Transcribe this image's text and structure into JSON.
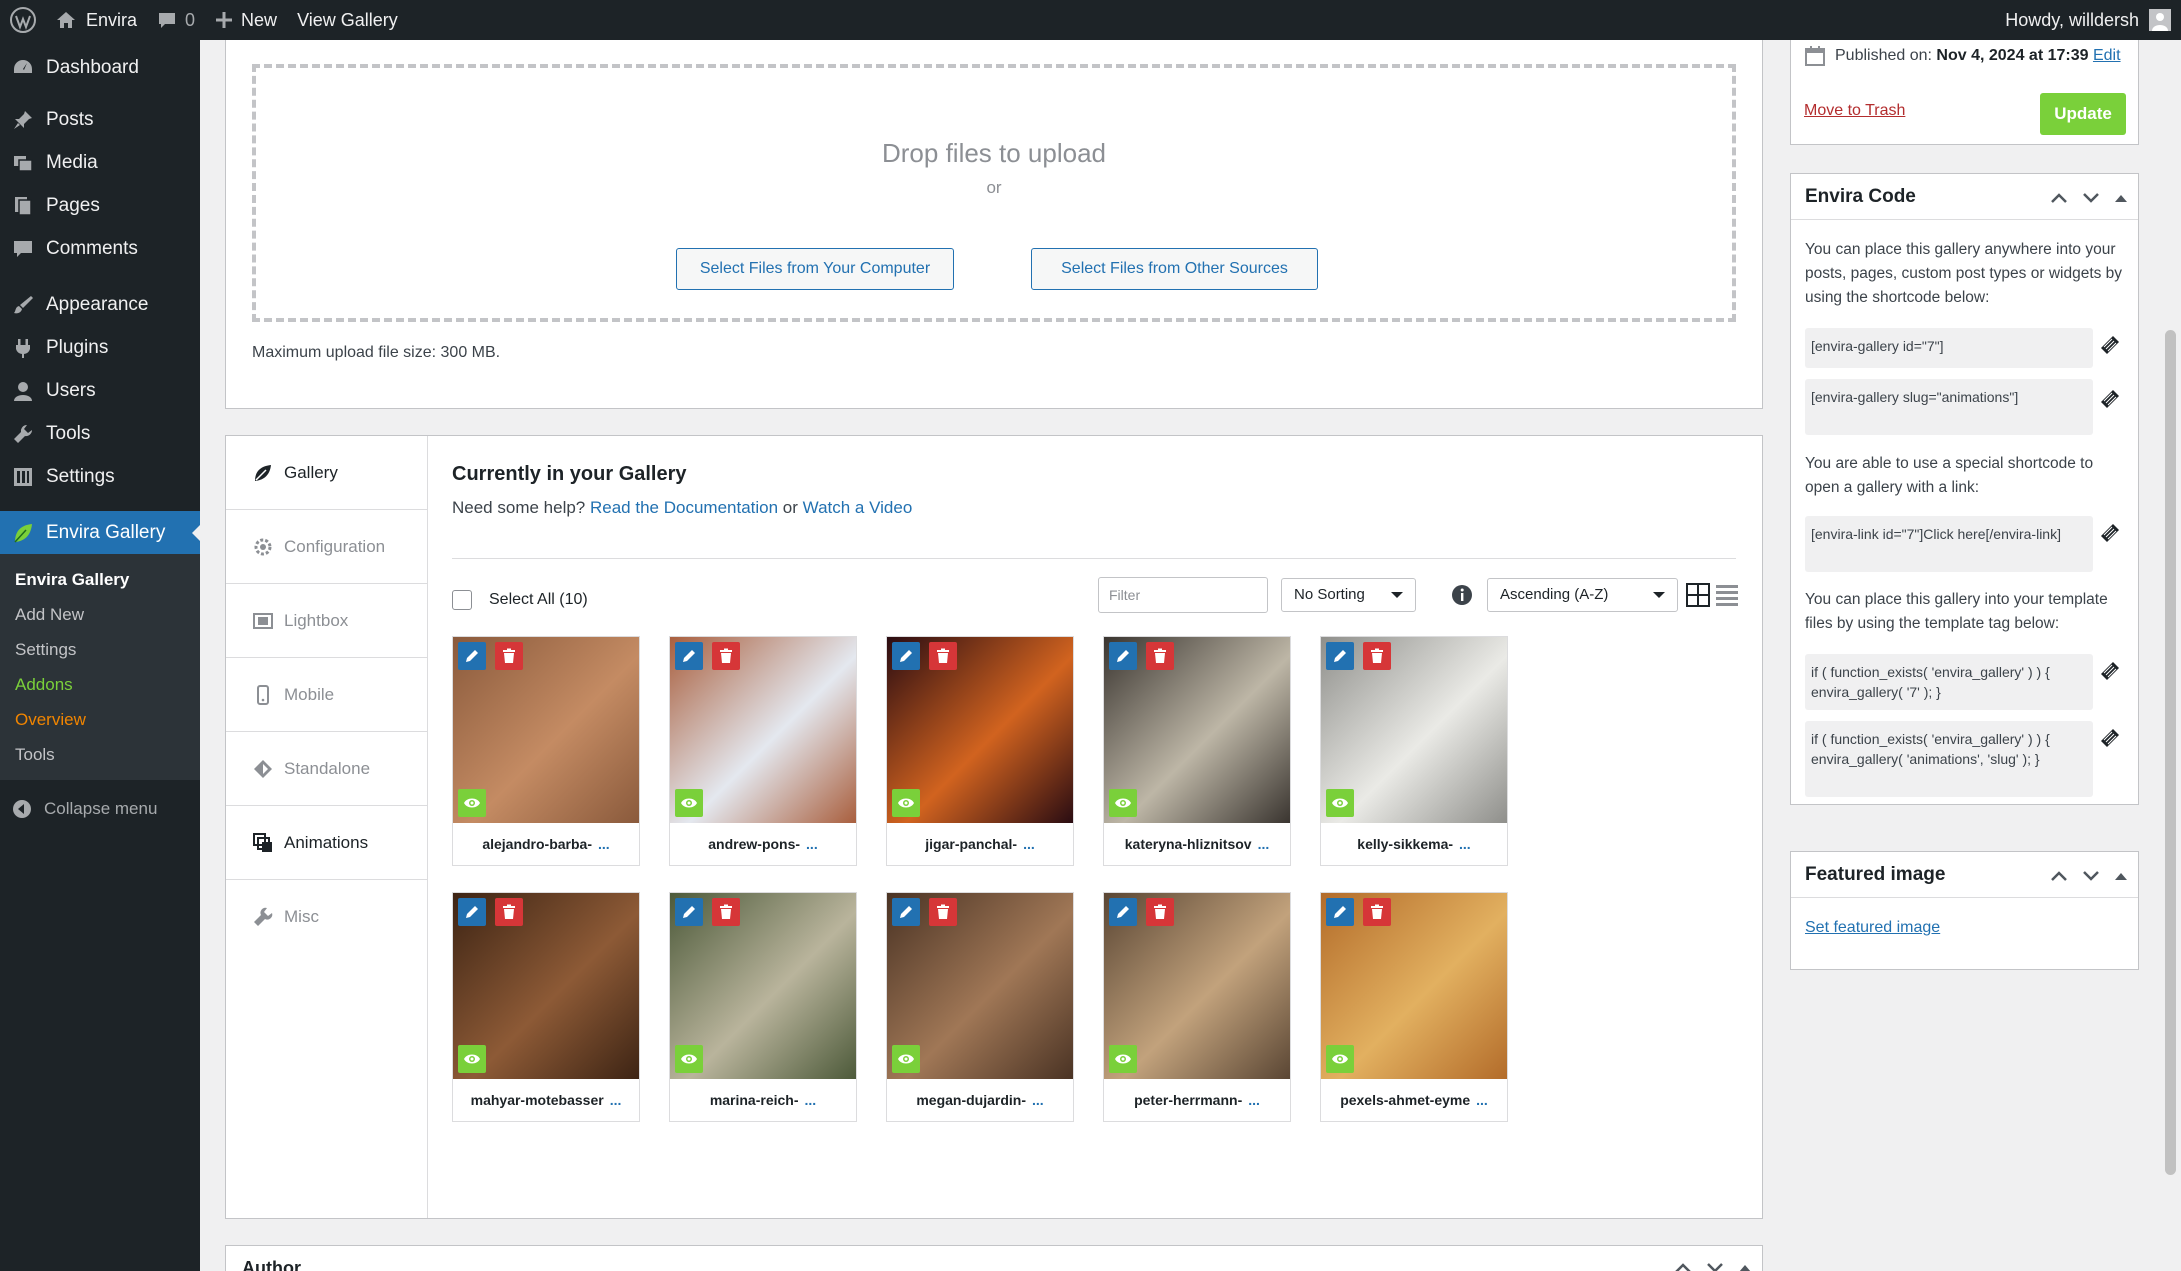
{
  "adminbar": {
    "site_name": "Envira",
    "comments_count": "0",
    "new_label": "New",
    "view_label": "View Gallery",
    "howdy": "Howdy, willdersh"
  },
  "sidebar": {
    "items": [
      {
        "label": "Dashboard",
        "icon": "dashboard-icon"
      },
      {
        "label": "Posts",
        "icon": "pin-icon"
      },
      {
        "label": "Media",
        "icon": "media-icon"
      },
      {
        "label": "Pages",
        "icon": "pages-icon"
      },
      {
        "label": "Comments",
        "icon": "comment-icon"
      },
      {
        "label": "Appearance",
        "icon": "brush-icon"
      },
      {
        "label": "Plugins",
        "icon": "plug-icon"
      },
      {
        "label": "Users",
        "icon": "user-icon"
      },
      {
        "label": "Tools",
        "icon": "wrench-icon"
      },
      {
        "label": "Settings",
        "icon": "settings-icon"
      }
    ],
    "current": "Envira Gallery",
    "submenu": [
      "Envira Gallery",
      "Add New",
      "Settings",
      "Addons",
      "Overview",
      "Tools"
    ],
    "collapse": "Collapse menu"
  },
  "upload": {
    "drop_title": "Drop files to upload",
    "or": "or",
    "btn_computer": "Select Files from Your Computer",
    "btn_other": "Select Files from Other Sources",
    "max_size": "Maximum upload file size: 300 MB."
  },
  "tabs": [
    "Gallery",
    "Configuration",
    "Lightbox",
    "Mobile",
    "Standalone",
    "Animations",
    "Misc"
  ],
  "gallery": {
    "title": "Currently in your Gallery",
    "help_prefix": "Need some help?",
    "doc_link": "Read the Documentation",
    "or": "or",
    "video_link": "Watch a Video",
    "select_all": "Select All (10)",
    "filter_placeholder": "Filter",
    "sorting": "No Sorting",
    "order": "Ascending (A-Z)",
    "dots": "...",
    "images": [
      {
        "name": "alejandro-barba-",
        "c1": "#8a5a3c",
        "c2": "#c48b63"
      },
      {
        "name": "andrew-pons-",
        "c1": "#a95f3e",
        "c2": "#e4e8ef"
      },
      {
        "name": "jigar-panchal-",
        "c1": "#2a0c12",
        "c2": "#d1631f"
      },
      {
        "name": "kateryna-hliznitsov",
        "c1": "#3a3530",
        "c2": "#bdb6a6"
      },
      {
        "name": "kelly-sikkema-",
        "c1": "#8f8f8b",
        "c2": "#eaeae6"
      },
      {
        "name": "mahyar-motebasser",
        "c1": "#3d2414",
        "c2": "#8d5a36"
      },
      {
        "name": "marina-reich-",
        "c1": "#4d5a3a",
        "c2": "#b9b49c"
      },
      {
        "name": "megan-dujardin-",
        "c1": "#4a3324",
        "c2": "#a07756"
      },
      {
        "name": "peter-herrmann-",
        "c1": "#5a4634",
        "c2": "#c2a27c"
      },
      {
        "name": "pexels-ahmet-eyme",
        "c1": "#b36c2a",
        "c2": "#e2b060"
      }
    ]
  },
  "author": {
    "title": "Author"
  },
  "publish": {
    "published_label": "Published on:",
    "published_date": "Nov 4, 2024 at 17:39",
    "edit": "Edit",
    "trash": "Move to Trash",
    "update": "Update"
  },
  "envira_code": {
    "title": "Envira Code",
    "text1": "You can place this gallery anywhere into your posts, pages, custom post types or widgets by using the shortcode below:",
    "code1": "[envira-gallery id=\"7\"]",
    "code2": "[envira-gallery slug=\"animations\"]",
    "text2": "You are able to use a special shortcode to open a gallery with a link:",
    "code3": "[envira-link id=\"7\"]Click here[/envira-link]",
    "text3": "You can place this gallery into your template files by using the template tag below:",
    "code4": "if ( function_exists( 'envira_gallery' ) ) { envira_gallery( '7' ); }",
    "code5": "if ( function_exists( 'envira_gallery' ) ) { envira_gallery( 'animations', 'slug' ); }"
  },
  "featured": {
    "title": "Featured image",
    "link": "Set featured image"
  }
}
